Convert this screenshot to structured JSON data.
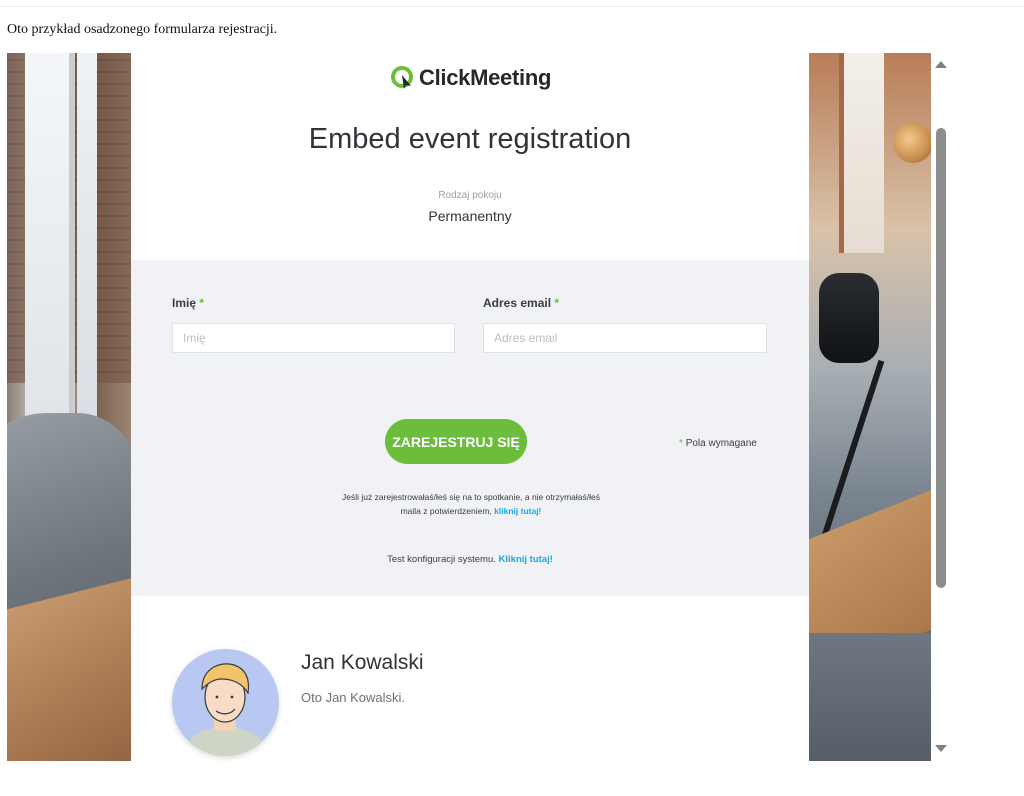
{
  "intro_text": "Oto przykład osadzonego formularza rejestracji.",
  "brand": {
    "name": "ClickMeeting",
    "accent": "#6bbd3b"
  },
  "event": {
    "title": "Embed event registration",
    "room_type_label": "Rodzaj pokoju",
    "room_type_value": "Permanentny"
  },
  "form": {
    "name_label": "Imię",
    "name_placeholder": "Imię",
    "email_label": "Adres email",
    "email_placeholder": "Adres email",
    "required_star": "*",
    "submit_label": "ZAREJESTRUJ SIĘ",
    "required_note": "Pola wymagane",
    "already_registered_text": "Jeśli już zarejestrowałaś/łeś się na to spotkanie, a nie otrzymałaś/łeś maila z potwierdzeniem,",
    "already_registered_link": "kliknij tutaj!",
    "system_test_text": "Test konfiguracji systemu.",
    "system_test_link": "Kliknij tutaj!"
  },
  "speaker": {
    "name": "Jan Kowalski",
    "description": "Oto Jan Kowalski."
  },
  "colors": {
    "link": "#1aa7e6",
    "form_background": "#f0f2f5",
    "text": "#303338"
  },
  "icons": [
    "clickmeeting-logo-icon",
    "scroll-up-arrow-icon",
    "scroll-down-arrow-icon"
  ]
}
